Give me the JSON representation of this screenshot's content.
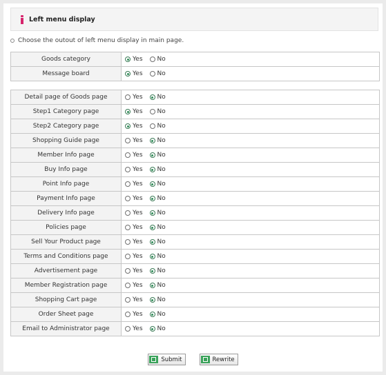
{
  "header": {
    "title": "Left menu display"
  },
  "description": "Choose the outout of left menu display in main page.",
  "options": {
    "yes": "Yes",
    "no": "No"
  },
  "group1": [
    {
      "label": "Goods category",
      "value": "yes"
    },
    {
      "label": "Message board",
      "value": "yes"
    }
  ],
  "group2": [
    {
      "label": "Detail page of Goods page",
      "value": "no"
    },
    {
      "label": "Step1 Category page",
      "value": "yes"
    },
    {
      "label": "Step2 Category page",
      "value": "yes"
    },
    {
      "label": "Shopping Guide page",
      "value": "no"
    },
    {
      "label": "Member Info page",
      "value": "no"
    },
    {
      "label": "Buy Info page",
      "value": "no"
    },
    {
      "label": "Point Info page",
      "value": "no"
    },
    {
      "label": "Payment Info page",
      "value": "no"
    },
    {
      "label": "Delivery Info page",
      "value": "no"
    },
    {
      "label": "Policies page",
      "value": "no"
    },
    {
      "label": "Sell Your Product page",
      "value": "no"
    },
    {
      "label": "Terms and Conditions page",
      "value": "no"
    },
    {
      "label": "Advertisement page",
      "value": "no"
    },
    {
      "label": "Member Registration page",
      "value": "no"
    },
    {
      "label": "Shopping Cart page",
      "value": "no"
    },
    {
      "label": "Order Sheet page",
      "value": "no"
    },
    {
      "label": "Email to Administrator page",
      "value": "no"
    }
  ],
  "buttons": {
    "submit": "Submit",
    "rewrite": "Rewrite"
  },
  "colors": {
    "accent": "#d6246c",
    "radio_selected": "#2e8b57",
    "button_icon": "#3aa25a"
  }
}
